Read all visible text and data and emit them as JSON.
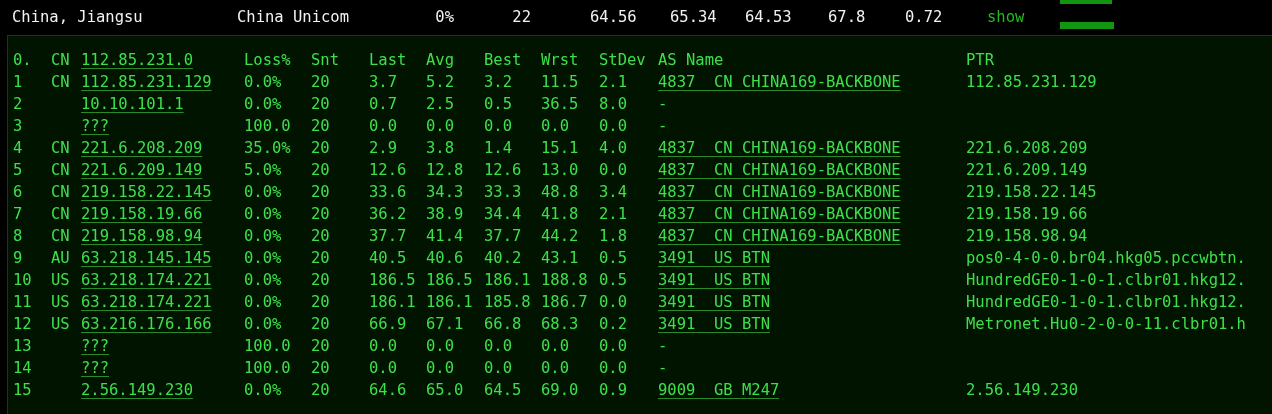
{
  "summary": {
    "location": "China, Jiangsu",
    "isp": "China Unicom",
    "loss": "0%",
    "snt": "22",
    "last": "64.56",
    "avg": "65.34",
    "best": "64.53",
    "wrst": "67.8",
    "stdev": "0.72",
    "action": "show"
  },
  "mtr": {
    "header": {
      "num": "0.",
      "country": "CN",
      "host": "112.85.231.0",
      "columns": [
        "Loss%",
        "Snt",
        "Last",
        "Avg",
        "Best",
        "Wrst",
        "StDev",
        "AS Name",
        "PTR"
      ]
    },
    "hops": [
      {
        "num": "1",
        "country": "CN",
        "host": "112.85.231.129",
        "loss": "0.0%",
        "snt": "20",
        "last": "3.7",
        "avg": "5.2",
        "best": "3.2",
        "wrst": "11.5",
        "stdev": "2.1",
        "as_linked": true,
        "as": "4837  CN CHINA169-BACKBONE",
        "ptr": "112.85.231.129"
      },
      {
        "num": "2",
        "host": "10.10.101.1",
        "loss": "0.0%",
        "snt": "20",
        "last": "0.7",
        "avg": "2.5",
        "best": "0.5",
        "wrst": "36.5",
        "stdev": "8.0",
        "as_linked": false,
        "as": "-"
      },
      {
        "num": "3",
        "host": "???",
        "loss": "100.0",
        "snt": "20",
        "last": "0.0",
        "avg": "0.0",
        "best": "0.0",
        "wrst": "0.0",
        "stdev": "0.0",
        "as_linked": false,
        "as": "-"
      },
      {
        "num": "4",
        "country": "CN",
        "host": "221.6.208.209",
        "loss": "35.0%",
        "snt": "20",
        "last": "2.9",
        "avg": "3.8",
        "best": "1.4",
        "wrst": "15.1",
        "stdev": "4.0",
        "as_linked": true,
        "as": "4837  CN CHINA169-BACKBONE",
        "ptr": "221.6.208.209"
      },
      {
        "num": "5",
        "country": "CN",
        "host": "221.6.209.149",
        "loss": "5.0%",
        "snt": "20",
        "last": "12.6",
        "avg": "12.8",
        "best": "12.6",
        "wrst": "13.0",
        "stdev": "0.0",
        "as_linked": true,
        "as": "4837  CN CHINA169-BACKBONE",
        "ptr": "221.6.209.149"
      },
      {
        "num": "6",
        "country": "CN",
        "host": "219.158.22.145",
        "loss": "0.0%",
        "snt": "20",
        "last": "33.6",
        "avg": "34.3",
        "best": "33.3",
        "wrst": "48.8",
        "stdev": "3.4",
        "as_linked": true,
        "as": "4837  CN CHINA169-BACKBONE",
        "ptr": "219.158.22.145"
      },
      {
        "num": "7",
        "country": "CN",
        "host": "219.158.19.66",
        "loss": "0.0%",
        "snt": "20",
        "last": "36.2",
        "avg": "38.9",
        "best": "34.4",
        "wrst": "41.8",
        "stdev": "2.1",
        "as_linked": true,
        "as": "4837  CN CHINA169-BACKBONE",
        "ptr": "219.158.19.66"
      },
      {
        "num": "8",
        "country": "CN",
        "host": "219.158.98.94",
        "loss": "0.0%",
        "snt": "20",
        "last": "37.7",
        "avg": "41.4",
        "best": "37.7",
        "wrst": "44.2",
        "stdev": "1.8",
        "as_linked": true,
        "as": "4837  CN CHINA169-BACKBONE",
        "ptr": "219.158.98.94"
      },
      {
        "num": "9",
        "country": "AU",
        "host": "63.218.145.145",
        "loss": "0.0%",
        "snt": "20",
        "last": "40.5",
        "avg": "40.6",
        "best": "40.2",
        "wrst": "43.1",
        "stdev": "0.5",
        "as_linked": true,
        "as": "3491  US BTN",
        "ptr": "pos0-4-0-0.br04.hkg05.pccwbtn."
      },
      {
        "num": "10",
        "country": "US",
        "host": "63.218.174.221",
        "loss": "0.0%",
        "snt": "20",
        "last": "186.5",
        "avg": "186.5",
        "best": "186.1",
        "wrst": "188.8",
        "stdev": "0.5",
        "as_linked": true,
        "as": "3491  US BTN",
        "ptr": "HundredGE0-1-0-1.clbr01.hkg12."
      },
      {
        "num": "11",
        "country": "US",
        "host": "63.218.174.221",
        "loss": "0.0%",
        "snt": "20",
        "last": "186.1",
        "avg": "186.1",
        "best": "185.8",
        "wrst": "186.7",
        "stdev": "0.0",
        "as_linked": true,
        "as": "3491  US BTN",
        "ptr": "HundredGE0-1-0-1.clbr01.hkg12."
      },
      {
        "num": "12",
        "country": "US",
        "host": "63.216.176.166",
        "loss": "0.0%",
        "snt": "20",
        "last": "66.9",
        "avg": "67.1",
        "best": "66.8",
        "wrst": "68.3",
        "stdev": "0.2",
        "as_linked": true,
        "as": "3491  US BTN",
        "ptr": "Metronet.Hu0-2-0-0-11.clbr01.h"
      },
      {
        "num": "13",
        "host": "???",
        "loss": "100.0",
        "snt": "20",
        "last": "0.0",
        "avg": "0.0",
        "best": "0.0",
        "wrst": "0.0",
        "stdev": "0.0",
        "as_linked": false,
        "as": "-"
      },
      {
        "num": "14",
        "host": "???",
        "loss": "100.0",
        "snt": "20",
        "last": "0.0",
        "avg": "0.0",
        "best": "0.0",
        "wrst": "0.0",
        "stdev": "0.0",
        "as_linked": false,
        "as": "-"
      },
      {
        "num": "15",
        "host": "2.56.149.230",
        "loss": "0.0%",
        "snt": "20",
        "last": "64.6",
        "avg": "65.0",
        "best": "64.5",
        "wrst": "69.0",
        "stdev": "0.9",
        "as_linked": true,
        "as": "9009  GB M247",
        "ptr": "2.56.149.230"
      }
    ]
  }
}
